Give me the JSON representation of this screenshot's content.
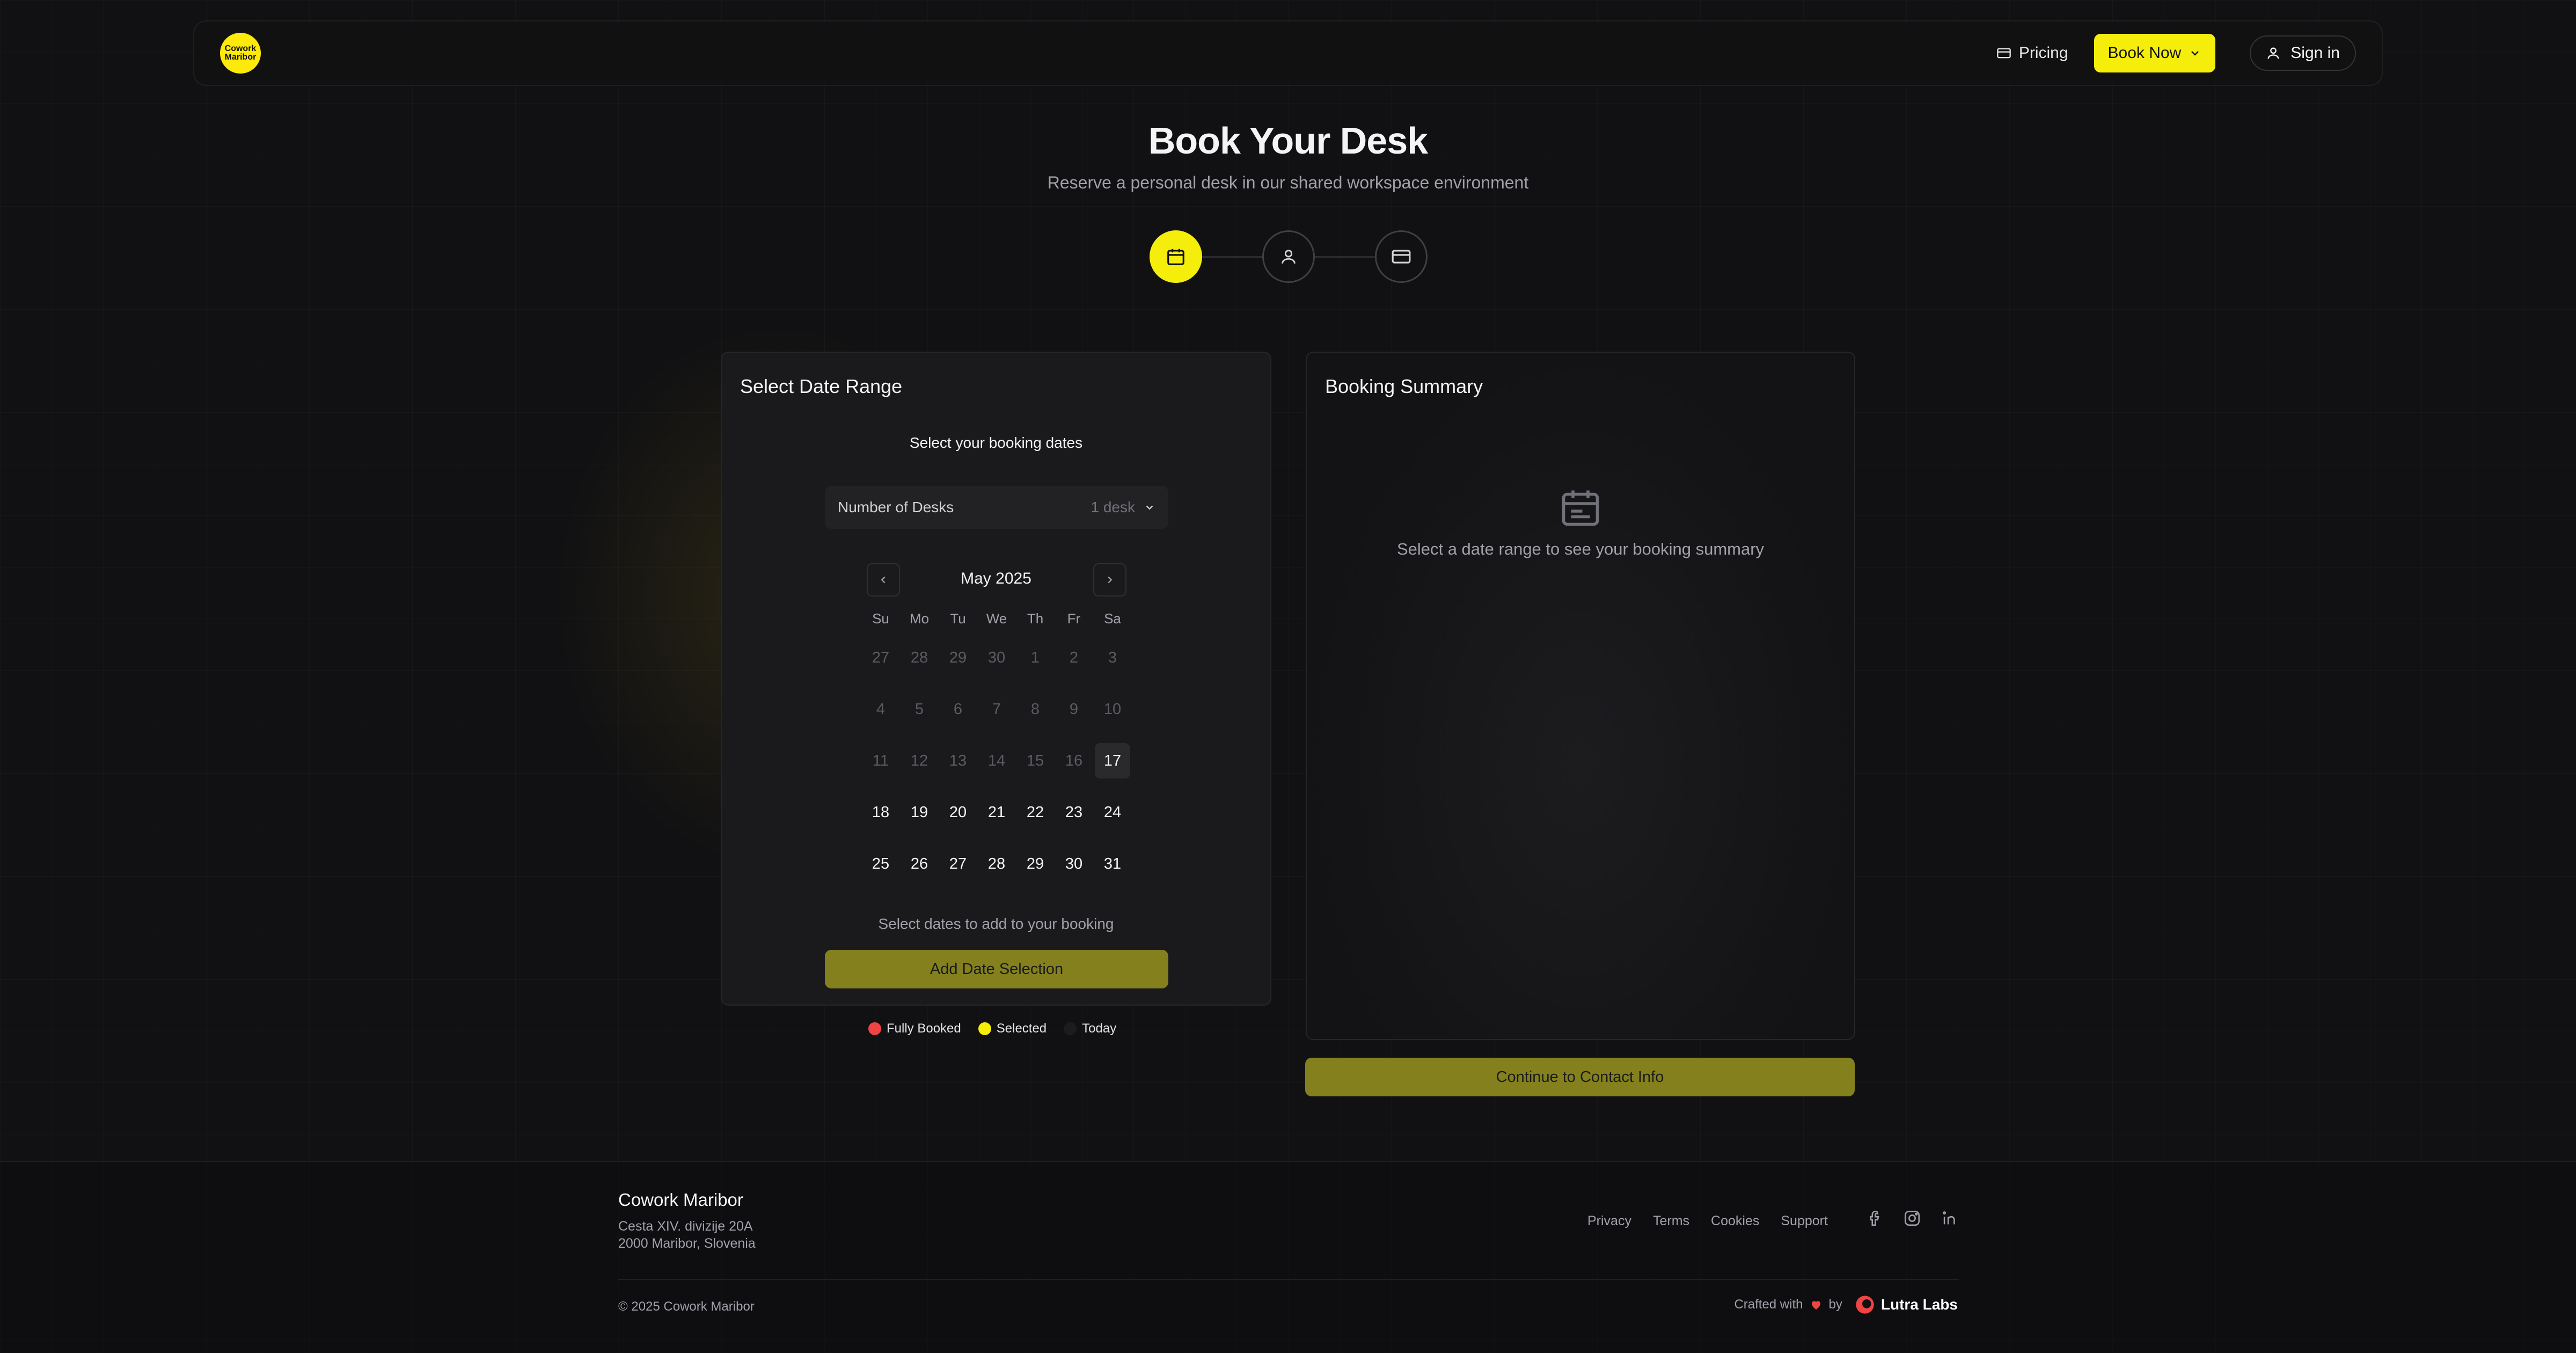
{
  "header": {
    "logo_text": "Cowork Maribor",
    "pricing_label": "Pricing",
    "book_now_label": "Book Now",
    "signin_label": "Sign in"
  },
  "page": {
    "title": "Book Your Desk",
    "subtitle": "Reserve a personal desk in our shared workspace environment"
  },
  "steps": [
    {
      "icon": "calendar-icon",
      "active": true
    },
    {
      "icon": "user-icon",
      "active": false
    },
    {
      "icon": "credit-card-icon",
      "active": false
    }
  ],
  "date_card": {
    "title": "Select Date Range",
    "subtitle": "Select your booking dates",
    "desks_label": "Number of Desks",
    "desks_value": "1 desk",
    "month": "May 2025",
    "weekdays": [
      "Su",
      "Mo",
      "Tu",
      "We",
      "Th",
      "Fr",
      "Sa"
    ],
    "days": [
      {
        "d": "27",
        "s": "muted"
      },
      {
        "d": "28",
        "s": "muted"
      },
      {
        "d": "29",
        "s": "muted"
      },
      {
        "d": "30",
        "s": "muted"
      },
      {
        "d": "1",
        "s": "muted"
      },
      {
        "d": "2",
        "s": "muted"
      },
      {
        "d": "3",
        "s": "muted"
      },
      {
        "d": "4",
        "s": "muted"
      },
      {
        "d": "5",
        "s": "muted"
      },
      {
        "d": "6",
        "s": "muted"
      },
      {
        "d": "7",
        "s": "muted"
      },
      {
        "d": "8",
        "s": "muted"
      },
      {
        "d": "9",
        "s": "muted"
      },
      {
        "d": "10",
        "s": "muted"
      },
      {
        "d": "11",
        "s": "muted"
      },
      {
        "d": "12",
        "s": "muted"
      },
      {
        "d": "13",
        "s": "muted"
      },
      {
        "d": "14",
        "s": "muted"
      },
      {
        "d": "15",
        "s": "muted"
      },
      {
        "d": "16",
        "s": "muted"
      },
      {
        "d": "17",
        "s": "today"
      },
      {
        "d": "18",
        "s": "available"
      },
      {
        "d": "19",
        "s": "available"
      },
      {
        "d": "20",
        "s": "available"
      },
      {
        "d": "21",
        "s": "available"
      },
      {
        "d": "22",
        "s": "available"
      },
      {
        "d": "23",
        "s": "available"
      },
      {
        "d": "24",
        "s": "available"
      },
      {
        "d": "25",
        "s": "available"
      },
      {
        "d": "26",
        "s": "available"
      },
      {
        "d": "27",
        "s": "available"
      },
      {
        "d": "28",
        "s": "available"
      },
      {
        "d": "29",
        "s": "available"
      },
      {
        "d": "30",
        "s": "available"
      },
      {
        "d": "31",
        "s": "available"
      }
    ],
    "hint": "Select dates to add to your booking",
    "add_button": "Add Date Selection"
  },
  "legend": [
    {
      "label": "Fully Booked",
      "color": "#ef4444"
    },
    {
      "label": "Selected",
      "color": "#f5ee0b"
    },
    {
      "label": "Today",
      "color": "#1c1c1f"
    }
  ],
  "summary_card": {
    "title": "Booking Summary",
    "empty_text": "Select a date range to see your booking summary",
    "continue_button": "Continue to Contact Info"
  },
  "footer": {
    "name": "Cowork Maribor",
    "address_line1": "Cesta XIV. divizije 20A",
    "address_line2": "2000 Maribor, Slovenia",
    "links": [
      "Privacy",
      "Terms",
      "Cookies",
      "Support"
    ],
    "social": [
      "facebook-icon",
      "instagram-icon",
      "linkedin-icon"
    ],
    "copyright": "© 2025 Cowork Maribor",
    "crafted_prefix": "Crafted with",
    "crafted_by": "by",
    "brand": "Lutra Labs"
  },
  "colors": {
    "accent": "#f5ee0b",
    "button_muted": "#84801e",
    "background": "#111113"
  }
}
